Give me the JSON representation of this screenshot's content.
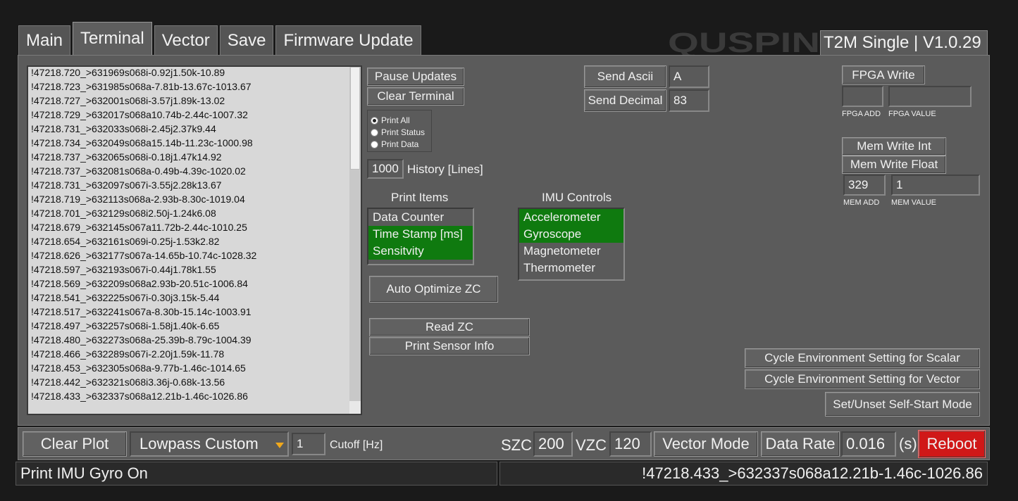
{
  "tabs": [
    {
      "label": "Main"
    },
    {
      "label": "Terminal"
    },
    {
      "label": "Vector"
    },
    {
      "label": "Save"
    },
    {
      "label": "Firmware Update"
    }
  ],
  "logo": {
    "text": "QUSPIN"
  },
  "app_title": "T2M Single | V1.0.29",
  "terminal_lines": [
    "!47218.720_>631969s068i-0.92j1.50k-10.89",
    "!47218.723_>631985s068a-7.81b-13.67c-1013.67",
    "!47218.727_>632001s068i-3.57j1.89k-13.02",
    "!47218.729_>632017s068a10.74b-2.44c-1007.32",
    "!47218.731_>632033s068i-2.45j2.37k9.44",
    "!47218.734_>632049s068a15.14b-11.23c-1000.98",
    "!47218.737_>632065s068i-0.18j1.47k14.92",
    "!47218.737_>632081s068a-0.49b-4.39c-1020.02",
    "!47218.731_>632097s067i-3.55j2.28k13.67",
    "!47218.719_>632113s068a-2.93b-8.30c-1019.04",
    "!47218.701_>632129s068i2.50j-1.24k6.08",
    "!47218.679_>632145s067a11.72b-2.44c-1010.25",
    "!47218.654_>632161s069i-0.25j-1.53k2.82",
    "!47218.626_>632177s067a-14.65b-10.74c-1028.32",
    "!47218.597_>632193s067i-0.44j1.78k1.55",
    "!47218.569_>632209s068a2.93b-20.51c-1006.84",
    "!47218.541_>632225s067i-0.30j3.15k-5.44",
    "!47218.517_>632241s067a-8.30b-15.14c-1003.91",
    "!47218.497_>632257s068i-1.58j1.40k-6.65",
    "!47218.480_>632273s068a-25.39b-8.79c-1004.39",
    "!47218.466_>632289s067i-2.20j1.59k-11.78",
    "!47218.453_>632305s068a-9.77b-1.46c-1014.65",
    "!47218.442_>632321s068i3.36j-0.68k-13.56",
    "!47218.433_>632337s068a12.21b-1.46c-1026.86"
  ],
  "controls": {
    "pause_updates": "Pause Updates",
    "clear_terminal": "Clear Terminal",
    "print_options": [
      {
        "label": "Print All",
        "selected": true
      },
      {
        "label": "Print Status",
        "selected": false
      },
      {
        "label": "Print Data",
        "selected": false
      }
    ],
    "history_value": "1000",
    "history_label": "History [Lines]",
    "print_items_title": "Print Items",
    "print_items": [
      {
        "label": "Data Counter",
        "selected": false
      },
      {
        "label": "Time Stamp [ms]",
        "selected": true
      },
      {
        "label": "Sensitvity",
        "selected": true
      }
    ],
    "imu_title": "IMU Controls",
    "imu_items": [
      {
        "label": "Accelerometer",
        "selected": true
      },
      {
        "label": "Gyroscope",
        "selected": true
      },
      {
        "label": "Magnetometer",
        "selected": false
      },
      {
        "label": "Thermometer",
        "selected": false
      }
    ],
    "auto_optimize": "Auto Optimize ZC",
    "read_zc": "Read ZC",
    "print_sensor_info": "Print Sensor Info",
    "send_ascii": "Send Ascii",
    "send_ascii_value": "A",
    "send_decimal": "Send Decimal",
    "send_decimal_value": "83",
    "fpga_write": "FPGA Write",
    "fpga_add_value": "",
    "fpga_value_value": "",
    "fpga_add_label": "FPGA ADD",
    "fpga_value_label": "FPGA VALUE",
    "mem_write_int": "Mem Write Int",
    "mem_write_float": "Mem Write Float",
    "mem_add_value": "329",
    "mem_value_value": "1",
    "mem_add_label": "MEM ADD",
    "mem_value_label": "MEM VALUE",
    "cycle_scalar": "Cycle Environment Setting for Scalar",
    "cycle_vector": "Cycle Environment Setting for Vector",
    "self_start": "Set/Unset Self-Start Mode"
  },
  "bottom": {
    "clear_plot": "Clear Plot",
    "filter_mode": "Lowpass Custom",
    "cutoff_value": "1",
    "cutoff_label": "Cutoff [Hz]",
    "szc_label": "SZC",
    "szc_value": "200",
    "vzc_label": "VZC",
    "vzc_value": "120",
    "vector_mode": "Vector Mode",
    "data_rate_label": "Data Rate",
    "data_rate_value": "0.016",
    "data_rate_unit": "(s)",
    "reboot": "Reboot"
  },
  "status": {
    "left": "Print IMU Gyro On",
    "right": "!47218.433_>632337s068a12.21b-1.46c-1026.86"
  },
  "colors": {
    "selected_green": "#0f7a0f",
    "reboot_red": "#d01818",
    "logo_orange": "#f0a81c"
  }
}
